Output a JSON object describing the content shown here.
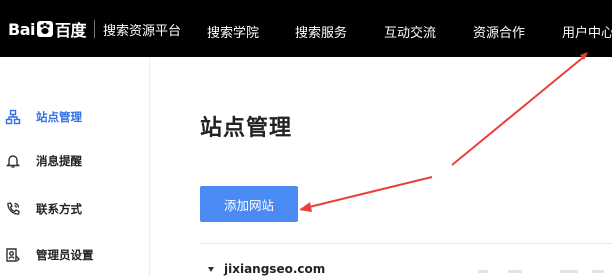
{
  "header": {
    "logo_text_left": "Bai",
    "logo_text_right": "百度",
    "platform_name": "搜索资源平台",
    "nav": [
      {
        "label": "搜索学院"
      },
      {
        "label": "搜索服务"
      },
      {
        "label": "互动交流"
      },
      {
        "label": "资源合作"
      },
      {
        "label": "用户中心"
      }
    ]
  },
  "sidebar": {
    "items": [
      {
        "label": "站点管理",
        "icon": "sitemap-icon",
        "active": true
      },
      {
        "label": "消息提醒",
        "icon": "bell-icon",
        "active": false
      },
      {
        "label": "联系方式",
        "icon": "phone-icon",
        "active": false
      },
      {
        "label": "管理员设置",
        "icon": "admin-icon",
        "active": false
      }
    ]
  },
  "main": {
    "title": "站点管理",
    "add_button_label": "添加网站",
    "site_name": "jixiangseo.com"
  },
  "colors": {
    "accent": "#2f6fe8",
    "button": "#4a8af4",
    "topbar": "#000000",
    "annotation_arrow": "#e8413a"
  }
}
